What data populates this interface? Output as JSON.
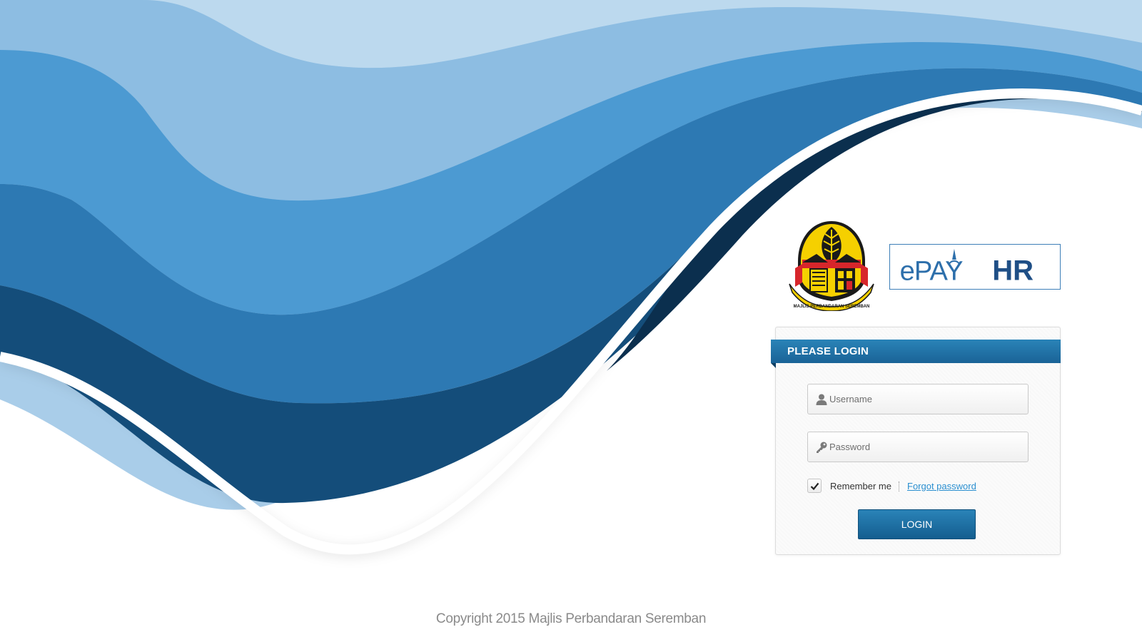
{
  "branding": {
    "crest_ribbon_text": "MAJLIS PERBANDARAN SEREMBAN",
    "app_logo_text_prefix": "ePAY",
    "app_logo_text_suffix": "HR"
  },
  "login": {
    "header_title": "PLEASE LOGIN",
    "username_placeholder": "Username",
    "username_value": "",
    "password_placeholder": "Password",
    "password_value": "",
    "remember_label": "Remember me",
    "remember_checked": true,
    "forgot_label": "Forgot password",
    "submit_label": "LOGIN"
  },
  "footer": {
    "copyright": "Copyright 2015 Majlis Perbandaran Seremban"
  },
  "colors": {
    "brand_blue": "#1a6397",
    "wave_light": "#b3d4ec",
    "wave_dark": "#0e3f63",
    "link": "#2a8fd0",
    "crest_yellow": "#f5d000",
    "crest_red": "#d7262b"
  },
  "icons": {
    "username_icon": "user-icon",
    "password_icon": "key-icon",
    "checkbox_icon": "checkmark-icon"
  }
}
